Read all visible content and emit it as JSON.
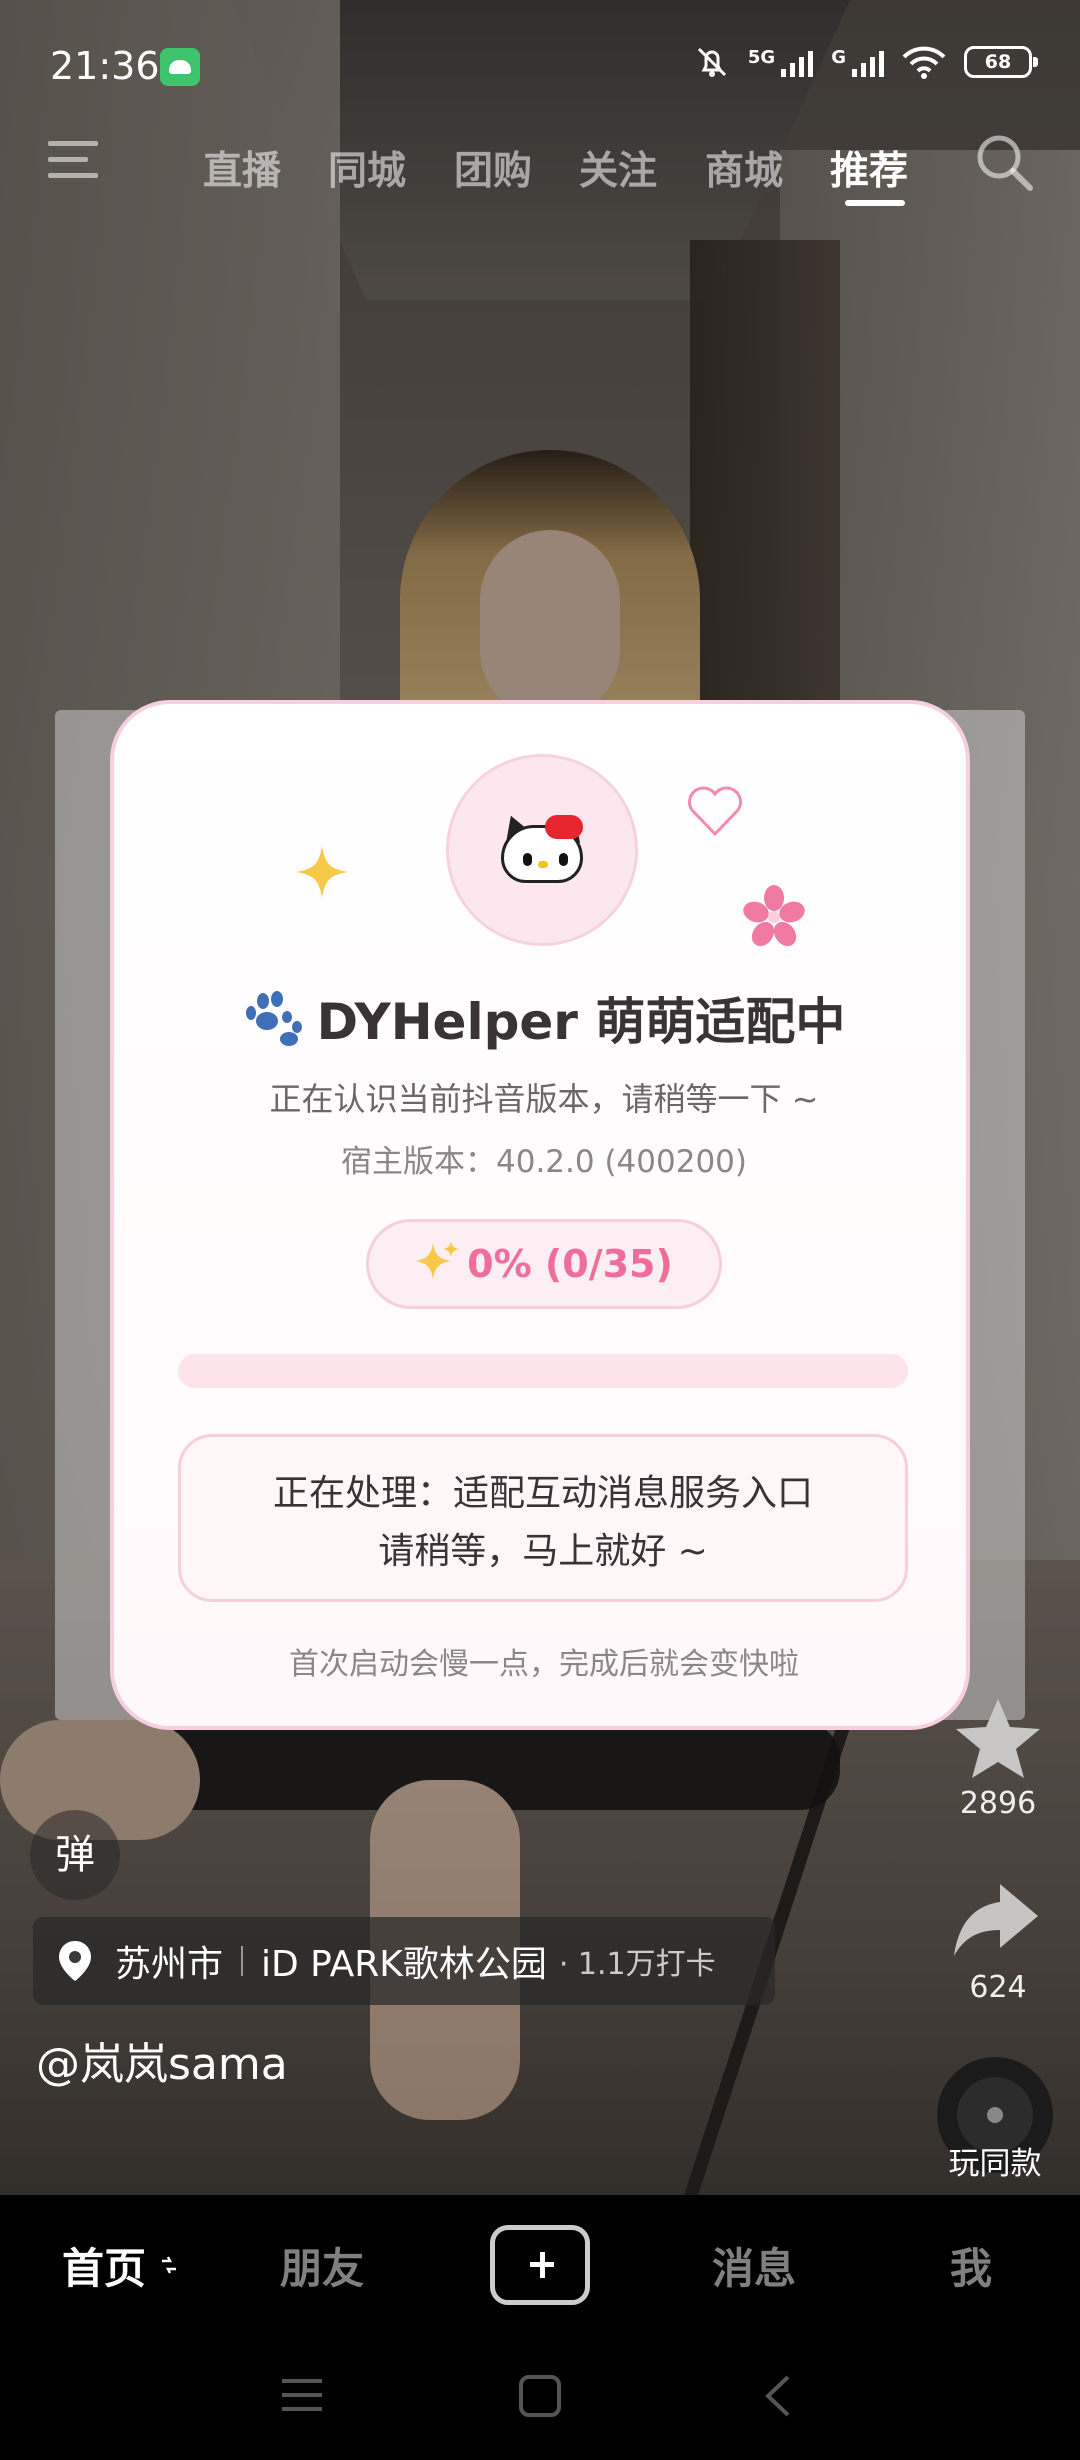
{
  "status_bar": {
    "time": "21:36",
    "sim1_label": "5G",
    "sim2_label": "G",
    "battery": "68"
  },
  "top_tabs": [
    {
      "label": "直播"
    },
    {
      "label": "同城"
    },
    {
      "label": "团购"
    },
    {
      "label": "关注"
    },
    {
      "label": "商城"
    },
    {
      "label": "推荐",
      "active": true
    }
  ],
  "side_actions": {
    "favorite_count": "2896",
    "share_count": "624",
    "same_style_label": "玩同款"
  },
  "danmu_label": "弹",
  "location": {
    "city": "苏州市",
    "place": "iD PARK歌林公园",
    "checkins": "· 1.1万打卡"
  },
  "author": "@岚岚sama",
  "bottom_nav": {
    "home": "首页",
    "friends": "朋友",
    "messages": "消息",
    "me": "我"
  },
  "dialog": {
    "title": "DYHelper 萌萌适配中",
    "subtitle": "正在认识当前抖音版本，请稍等一下 ~",
    "host_version": "宿主版本：40.2.0 (400200)",
    "progress_text": "0% (0/35)",
    "progress_fraction": 0,
    "status_line1": "正在处理：适配互动消息服务入口",
    "status_line2": "请稍等，马上就好 ~",
    "footer": "首次启动会慢一点，完成后就会变快啦",
    "accent_color": "#ef6d9b",
    "border_color": "#f7cfe0"
  }
}
